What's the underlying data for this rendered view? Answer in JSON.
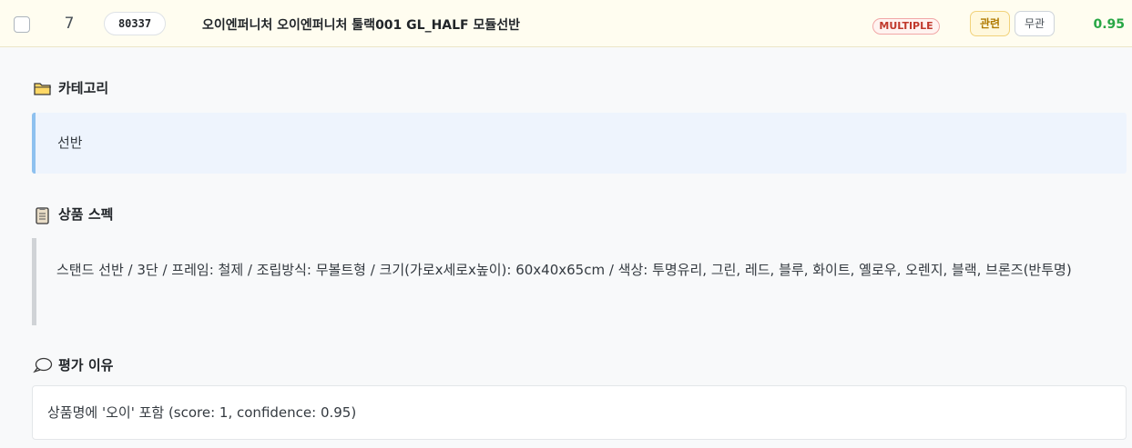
{
  "row": {
    "rank": "7",
    "product_code": "80337",
    "product_name": "오이엔퍼니처 오이엔퍼니처 툴랙001 GL_HALF 모듈선반",
    "match_badge": "MULTIPLE",
    "relevant_label": "관련",
    "irrelevant_label": "무관",
    "score": "0.95"
  },
  "category": {
    "title": "카테고리",
    "icon": "folder-icon",
    "value": "선반"
  },
  "spec": {
    "title": "상품 스펙",
    "icon": "clipboard-icon",
    "value": "스탠드 선반 / 3단 / 프레임: 철제 / 조립방식: 무볼트형 / 크기(가로x세로x높이): 60x40x65cm / 색상: 투명유리, 그린, 레드, 블루, 화이트, 옐로우, 오렌지, 블랙, 브론즈(반투명)"
  },
  "reason": {
    "title": "평가 이유",
    "icon": "speech-bubble-icon",
    "value": "상품명에 '오이' 포함 (score: 1, confidence: 0.95)"
  },
  "colors": {
    "row_bg": "#fffdf0",
    "score": "#28a745",
    "multiple_badge": "#c0392b",
    "relevant_btn": "#b07a00",
    "category_accent": "#8ec1ef"
  }
}
